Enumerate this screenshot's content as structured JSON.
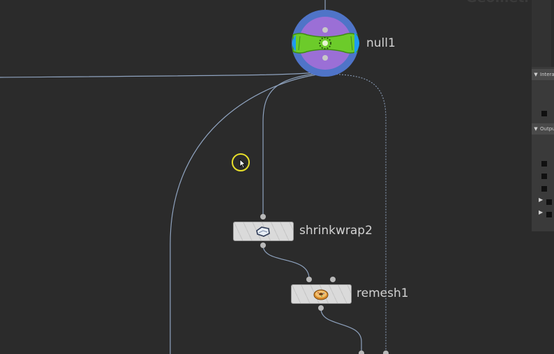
{
  "network": {
    "context_label": "Geometry",
    "nodes": {
      "null1": {
        "label": "null1"
      },
      "shrinkwrap2": {
        "label": "shrinkwrap2"
      },
      "remesh1": {
        "label": "remesh1"
      }
    }
  },
  "parameter_panel": {
    "sections": [
      {
        "label": "Interactive"
      },
      {
        "label": "Output"
      }
    ]
  },
  "colors": {
    "background": "#2b2b2b",
    "wire": "#8fa3bf",
    "null_ring": "#4f74c8",
    "null_center": "#9b6fd6",
    "null_bone": "#6ccb2a",
    "null_cap": "#1e9cf0",
    "cursor_ring": "#e8e02a"
  }
}
